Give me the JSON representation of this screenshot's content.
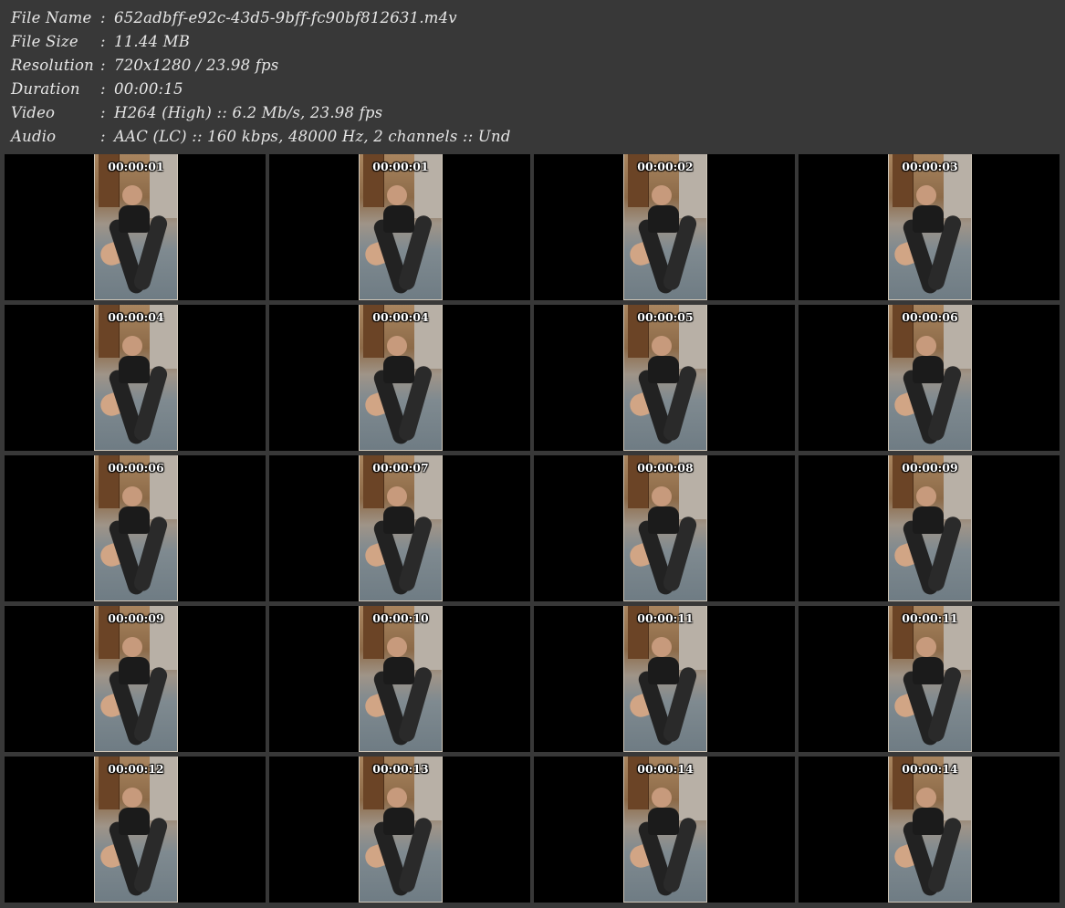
{
  "info": {
    "file_name_label": "File Name",
    "file_name_value": "652adbff-e92c-43d5-9bff-fc90bf812631.m4v",
    "file_size_label": "File Size",
    "file_size_value": "11.44 MB",
    "resolution_label": "Resolution",
    "resolution_value": "720x1280 / 23.98 fps",
    "duration_label": "Duration",
    "duration_value": "00:00:15",
    "video_label": "Video",
    "video_value": "H264 (High) :: 6.2 Mb/s, 23.98 fps",
    "audio_label": "Audio",
    "audio_value": "AAC (LC) :: 160 kbps, 48000 Hz, 2 channels :: Und",
    "separator": ":"
  },
  "thumbnails": [
    "00:00:01",
    "00:00:01",
    "00:00:02",
    "00:00:03",
    "00:00:04",
    "00:00:04",
    "00:00:05",
    "00:00:06",
    "00:00:06",
    "00:00:07",
    "00:00:08",
    "00:00:09",
    "00:00:09",
    "00:00:10",
    "00:00:11",
    "00:00:11",
    "00:00:12",
    "00:00:13",
    "00:00:14",
    "00:00:14"
  ]
}
